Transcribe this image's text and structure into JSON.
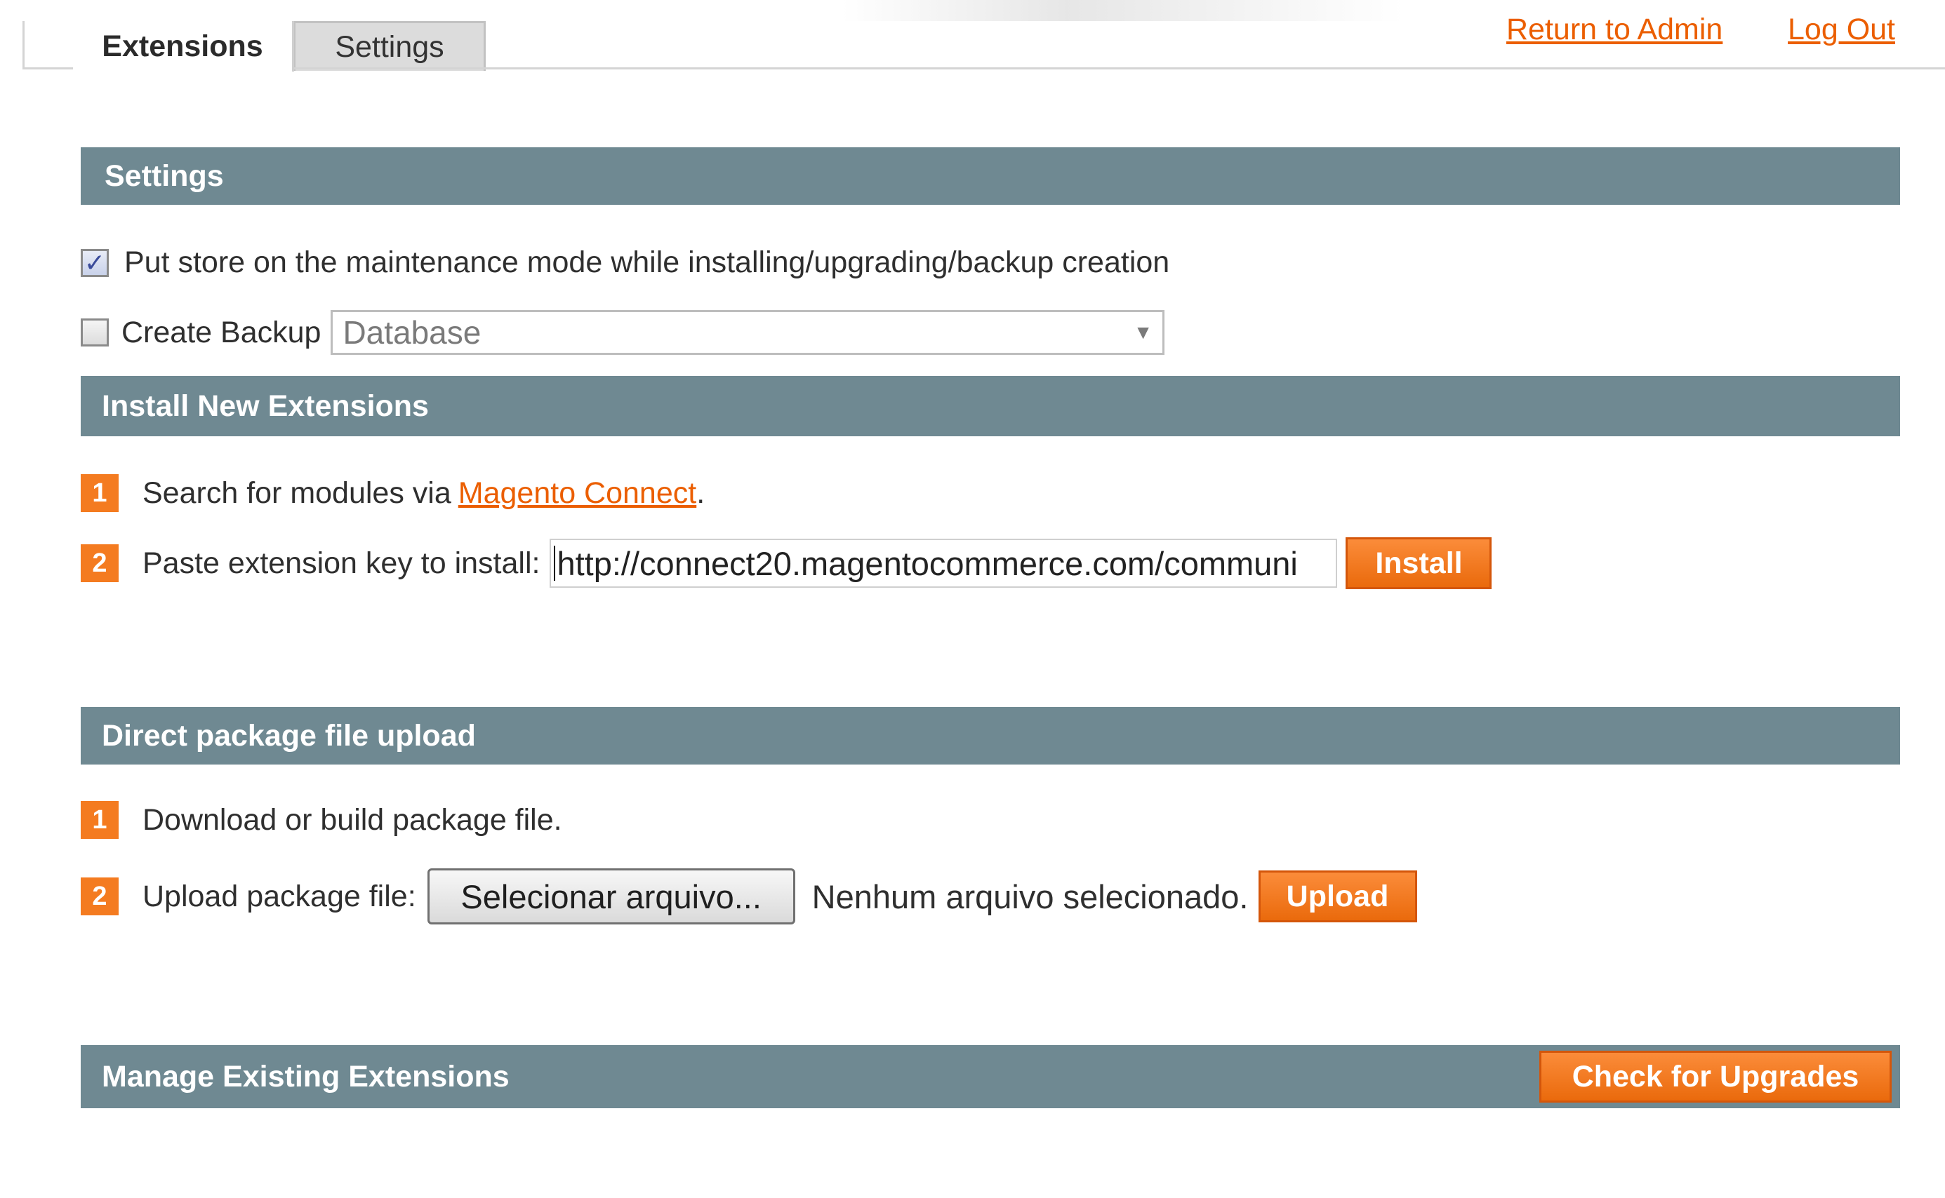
{
  "tabs": [
    {
      "label": "Extensions",
      "active": true
    },
    {
      "label": "Settings",
      "active": false
    }
  ],
  "header_links": {
    "return_admin": "Return to Admin",
    "logout": "Log Out"
  },
  "settings": {
    "title": "Settings",
    "maintenance_label": "Put store on the maintenance mode while installing/upgrading/backup creation",
    "maintenance_checked": true,
    "backup_label": "Create Backup",
    "backup_checked": false,
    "backup_type_selected": "Database"
  },
  "install": {
    "title": "Install New Extensions",
    "step1_number": "1",
    "step1_text": "Search for modules via ",
    "step1_link": "Magento Connect",
    "step1_suffix": ".",
    "step2_number": "2",
    "step2_label": "Paste extension key to install:",
    "extension_key_value": "http://connect20.magentocommerce.com/communi",
    "install_button": "Install"
  },
  "upload": {
    "title": "Direct package file upload",
    "step1_number": "1",
    "step1_text": "Download or build package file.",
    "step2_number": "2",
    "step2_label": "Upload package file:",
    "choose_file_button": "Selecionar arquivo...",
    "file_status": "Nenhum arquivo selecionado.",
    "upload_button": "Upload"
  },
  "manage": {
    "title": "Manage Existing Extensions",
    "check_upgrades_button": "Check for Upgrades"
  },
  "colors": {
    "section_header_bg": "#6f8992",
    "accent_orange": "#f47b20",
    "link_orange": "#eb5e00"
  },
  "icons": {
    "checkmark": "checkmark-icon",
    "dropdown": "chevron-down-icon"
  }
}
